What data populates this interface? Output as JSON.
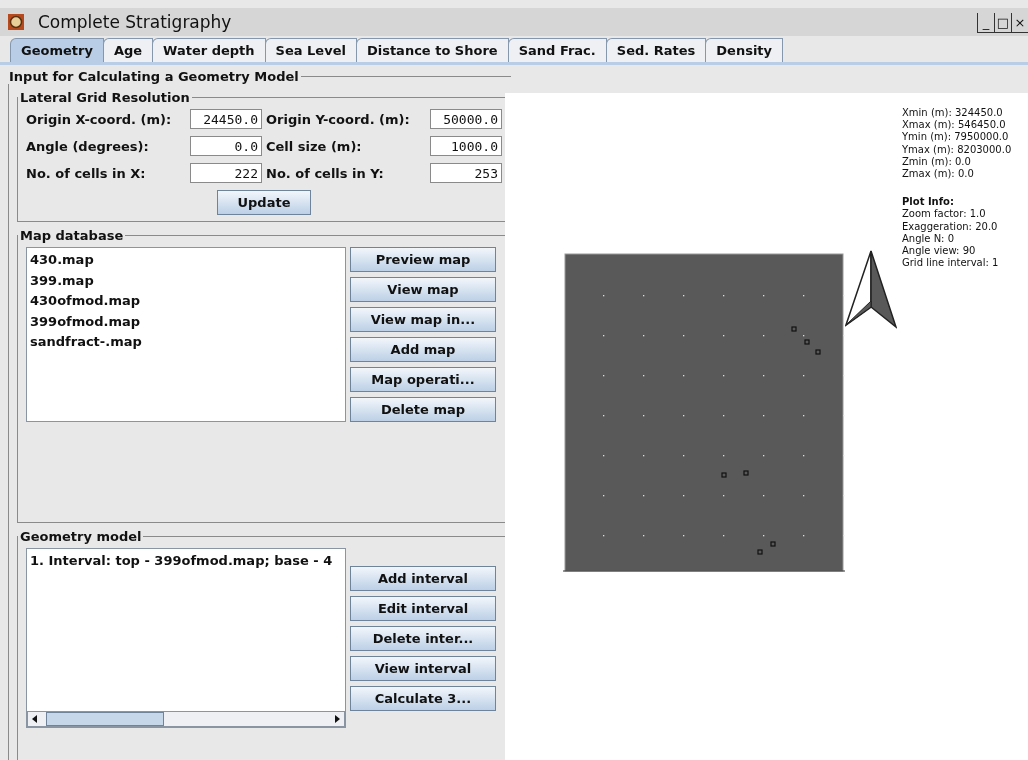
{
  "window": {
    "title": "Complete Stratigraphy",
    "controls": [
      "_",
      "□",
      "×"
    ]
  },
  "tabs": [
    {
      "label": "Geometry",
      "selected": true
    },
    {
      "label": "Age",
      "selected": false
    },
    {
      "label": "Water depth",
      "selected": false
    },
    {
      "label": "Sea Level",
      "selected": false
    },
    {
      "label": "Distance to Shore",
      "selected": false
    },
    {
      "label": "Sand Frac.",
      "selected": false
    },
    {
      "label": "Sed. Rates",
      "selected": false
    },
    {
      "label": "Density",
      "selected": false
    }
  ],
  "panel": {
    "title": "Input for Calculating a Geometry Model",
    "grid": {
      "title": "Lateral Grid Resolution",
      "fields": [
        {
          "label": "Origin X-coord. (m):",
          "value": "24450.0"
        },
        {
          "label": "Origin Y-coord. (m):",
          "value": "50000.0"
        },
        {
          "label": "Angle (degrees):",
          "value": "0.0"
        },
        {
          "label": "Cell size (m):",
          "value": "1000.0"
        },
        {
          "label": "No. of cells in X:",
          "value": "222"
        },
        {
          "label": "No. of cells in Y:",
          "value": "253"
        }
      ],
      "button": "Update"
    },
    "map_database": {
      "title": "Map database",
      "items": [
        "430.map",
        "399.map",
        "430ofmod.map",
        "399ofmod.map",
        "sandfract-.map"
      ],
      "buttons": [
        "Preview map",
        "View map",
        "View map in...",
        "Add map",
        "Map operati...",
        "Delete map"
      ]
    },
    "geometry_model": {
      "title": "Geometry model",
      "items": [
        "1. Interval: top - 399ofmod.map; base - 4"
      ],
      "buttons": [
        "Add interval",
        "Edit interval",
        "Delete inter...",
        "View interval",
        "Calculate 3..."
      ]
    }
  },
  "plot": {
    "extent": [
      "Xmin (m): 324450.0",
      "Xmax (m): 546450.0",
      "Ymin (m): 7950000.0",
      "Ymax (m): 8203000.0",
      "Zmin (m): 0.0",
      "Zmax (m): 0.0"
    ],
    "info_title": "Plot Info:",
    "info": [
      "Zoom factor: 1.0",
      "Exaggeration: 20.0",
      "Angle N: 0",
      "Angle view: 90",
      "Grid line interval: 1"
    ]
  }
}
